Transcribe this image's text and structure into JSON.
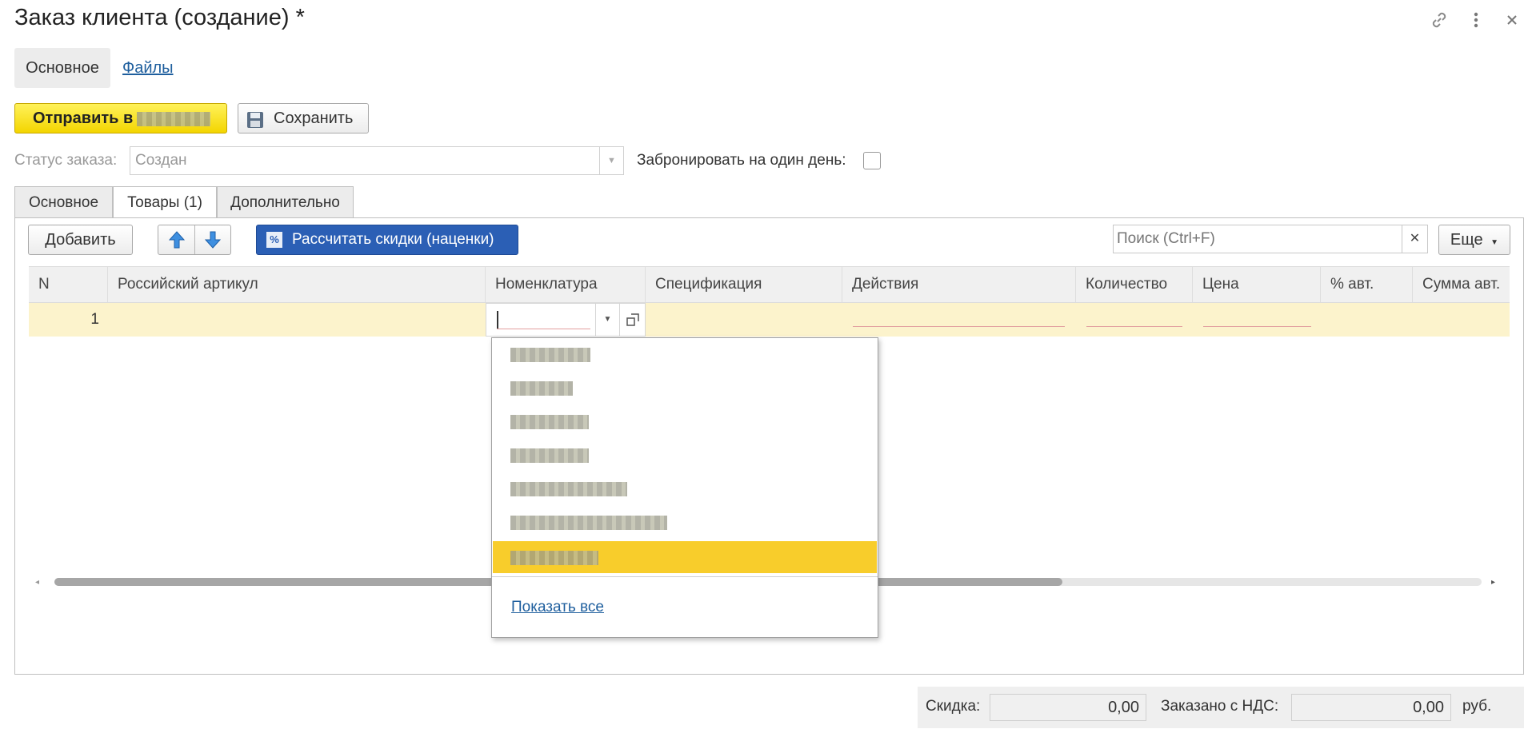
{
  "window": {
    "title": "Заказ клиента (создание) *"
  },
  "top_nav": {
    "main": "Основное",
    "files": "Файлы"
  },
  "toolbar": {
    "send_label": "Отправить в",
    "save_label": "Сохранить"
  },
  "status": {
    "label": "Статус заказа:",
    "value": "Создан"
  },
  "reserve": {
    "label": "Забронировать на один день:",
    "checked": false
  },
  "tabs": [
    {
      "label": "Основное",
      "active": false
    },
    {
      "label": "Товары (1)",
      "active": true
    },
    {
      "label": "Дополнительно",
      "active": false
    }
  ],
  "table_toolbar": {
    "add_label": "Добавить",
    "calc_label": "Рассчитать скидки (наценки)",
    "search_placeholder": "Поиск (Ctrl+F)",
    "more_label": "Еще"
  },
  "table": {
    "columns": [
      "N",
      "Российский артикул",
      "Номенклатура",
      "Спецификация",
      "Действия",
      "Количество",
      "Цена",
      "% авт.",
      "Сумма авт."
    ],
    "rows": [
      {
        "n": "1"
      }
    ]
  },
  "dropdown": {
    "show_all": "Показать все"
  },
  "footer": {
    "discount_label": "Скидка:",
    "discount_value": "0,00",
    "ordered_label": "Заказано с НДС:",
    "ordered_value": "0,00",
    "currency": "руб."
  },
  "colors": {
    "accent_yellow": "#f7d117",
    "button_blue": "#2b5fb5",
    "row_highlight": "#fcf3cc",
    "link": "#1f5f9e"
  }
}
